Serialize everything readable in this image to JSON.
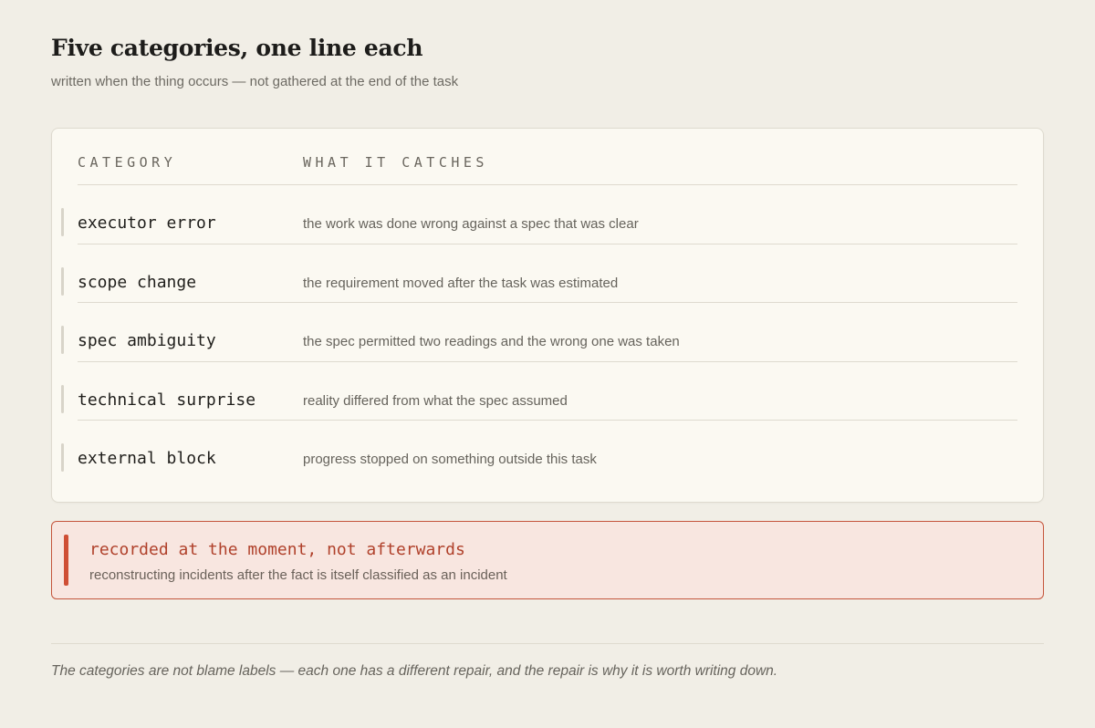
{
  "header": {
    "title": "Five categories, one line each",
    "subtitle": "written when the thing occurs — not gathered at the end of the task"
  },
  "table": {
    "columns": [
      "CATEGORY",
      "WHAT IT CATCHES"
    ],
    "rows": [
      {
        "category": "executor error",
        "catches": "the work was done wrong against a spec that was clear"
      },
      {
        "category": "scope change",
        "catches": "the requirement moved after the task was estimated"
      },
      {
        "category": "spec ambiguity",
        "catches": "the spec permitted two readings and the wrong one was taken"
      },
      {
        "category": "technical surprise",
        "catches": "reality differed from what the spec assumed"
      },
      {
        "category": "external block",
        "catches": "progress stopped on something outside this task"
      }
    ]
  },
  "callout": {
    "title": "recorded at the moment, not afterwards",
    "text": "reconstructing incidents after the fact is itself classified as an incident",
    "accent_color": "#cf4f35"
  },
  "footnote": "The categories are not blame labels — each one has a different repair, and the repair is why it is worth writing down."
}
